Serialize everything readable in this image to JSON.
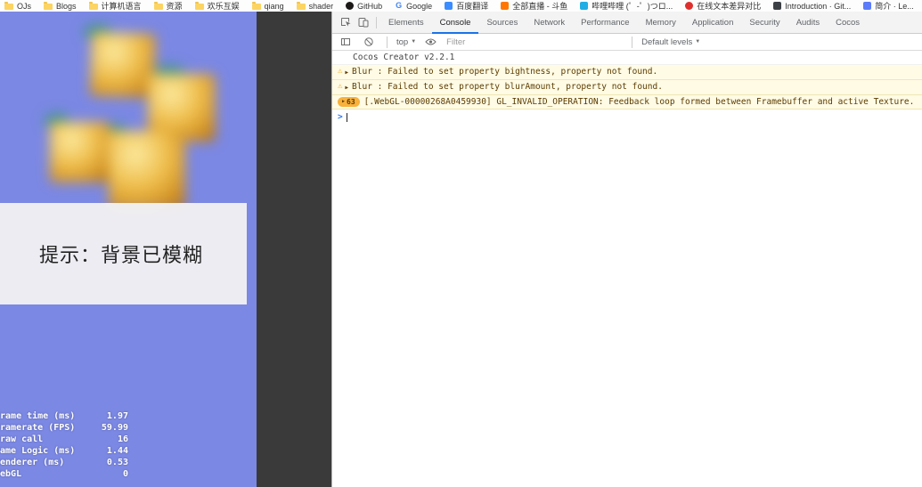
{
  "bookmarks_bar": {
    "items": [
      {
        "label": "OJs",
        "icon": "folder"
      },
      {
        "label": "Blogs",
        "icon": "folder"
      },
      {
        "label": "计算机语言",
        "icon": "folder"
      },
      {
        "label": "资源",
        "icon": "folder"
      },
      {
        "label": "欢乐互娱",
        "icon": "folder"
      },
      {
        "label": "qiang",
        "icon": "folder"
      },
      {
        "label": "shader",
        "icon": "folder"
      },
      {
        "label": "GitHub",
        "icon": "github"
      },
      {
        "label": "Google",
        "icon": "google"
      },
      {
        "label": "百度翻译",
        "icon": "baidu-translate"
      },
      {
        "label": "全部直播 - 斗鱼",
        "icon": "douyu"
      },
      {
        "label": "哔哩哔哩 (゜-゜)つロ...",
        "icon": "bilibili"
      },
      {
        "label": "在线文本差异对比",
        "icon": "text-diff"
      },
      {
        "label": "Introduction · Git...",
        "icon": "git-book"
      },
      {
        "label": "简介 · Le...",
        "icon": "learn-doc"
      }
    ]
  },
  "game": {
    "hint_text": "提示：背景已模糊",
    "stats": [
      {
        "label": "Frame time (ms)",
        "value": "1.97"
      },
      {
        "label": "Framerate (FPS)",
        "value": "59.99"
      },
      {
        "label": "Draw call",
        "value": "16"
      },
      {
        "label": "Game Logic (ms)",
        "value": "1.44"
      },
      {
        "label": "Renderer (ms)",
        "value": "0.53"
      },
      {
        "label": "WebGL",
        "value": "0"
      }
    ]
  },
  "devtools": {
    "tabs": [
      {
        "label": "Elements",
        "active": false
      },
      {
        "label": "Console",
        "active": true
      },
      {
        "label": "Sources",
        "active": false
      },
      {
        "label": "Network",
        "active": false
      },
      {
        "label": "Performance",
        "active": false
      },
      {
        "label": "Memory",
        "active": false
      },
      {
        "label": "Application",
        "active": false
      },
      {
        "label": "Security",
        "active": false
      },
      {
        "label": "Audits",
        "active": false
      },
      {
        "label": "Cocos",
        "active": false
      }
    ],
    "toolbar": {
      "context_label": "top",
      "filter_placeholder": "Filter",
      "levels_label": "Default levels"
    },
    "console": {
      "messages": [
        {
          "type": "log",
          "text": "Cocos Creator v2.2.1"
        },
        {
          "type": "warning",
          "text": "Blur : Failed to set property bightness, property not found."
        },
        {
          "type": "warning",
          "text": "Blur : Failed to set property blurAmount, property not found."
        },
        {
          "type": "warning",
          "count": "63",
          "text": "[.WebGL-00000268A0459930] GL_INVALID_OPERATION: Feedback loop formed between Framebuffer and active Texture."
        }
      ],
      "prompt": ">"
    }
  },
  "colors": {
    "game_background": "#7b88e4",
    "page_background": "#3a3a3a",
    "warning_background": "#fffbe5",
    "warning_text": "#5c3c00",
    "active_tab_accent": "#1a73e8",
    "hint_box_background": "#f1f0f3"
  }
}
